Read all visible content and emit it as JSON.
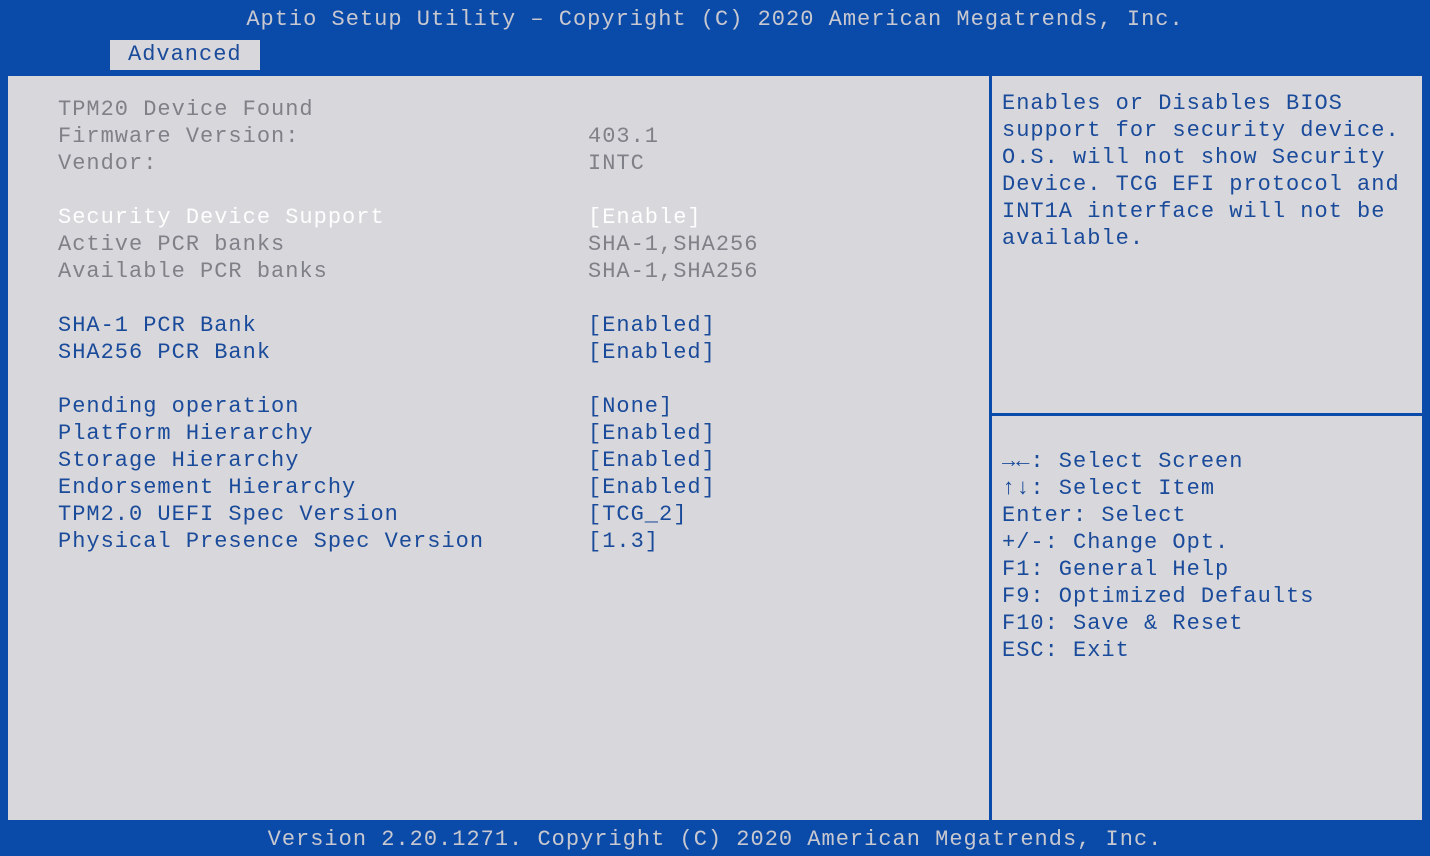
{
  "header": {
    "title": "Aptio Setup Utility – Copyright (C) 2020 American Megatrends, Inc."
  },
  "tabs": {
    "active": "Advanced"
  },
  "info": {
    "device_found": "TPM20 Device Found",
    "firmware_label": "Firmware Version:",
    "firmware_value": "403.1",
    "vendor_label": "Vendor:",
    "vendor_value": "INTC"
  },
  "settings": {
    "security_device_support": {
      "label": "Security Device Support",
      "value": "[Enable]"
    },
    "active_pcr_banks": {
      "label": "Active PCR banks",
      "value": "SHA-1,SHA256"
    },
    "available_pcr_banks": {
      "label": "Available PCR banks",
      "value": "SHA-1,SHA256"
    },
    "sha1_pcr_bank": {
      "label": "SHA-1 PCR Bank",
      "value": "[Enabled]"
    },
    "sha256_pcr_bank": {
      "label": "SHA256 PCR Bank",
      "value": "[Enabled]"
    },
    "pending_operation": {
      "label": "Pending operation",
      "value": "[None]"
    },
    "platform_hierarchy": {
      "label": "Platform Hierarchy",
      "value": "[Enabled]"
    },
    "storage_hierarchy": {
      "label": "Storage Hierarchy",
      "value": "[Enabled]"
    },
    "endorsement_hierarchy": {
      "label": "Endorsement Hierarchy",
      "value": "[Enabled]"
    },
    "tpm_uefi_spec": {
      "label": "TPM2.0 UEFI Spec Version",
      "value": "[TCG_2]"
    },
    "physical_presence": {
      "label": "Physical Presence Spec Version",
      "value": "[1.3]"
    }
  },
  "help": {
    "line1": "Enables or Disables BIOS",
    "line2": "support for security device.",
    "line3": "O.S. will not show Security",
    "line4": "Device. TCG EFI protocol and",
    "line5": "INT1A interface will not be",
    "line6": "available."
  },
  "nav": {
    "select_screen": "→←: Select Screen",
    "select_item": "↑↓: Select Item",
    "enter": "Enter: Select",
    "change": "+/-: Change Opt.",
    "f1": "F1: General Help",
    "f9": "F9: Optimized Defaults",
    "f10": "F10: Save & Reset",
    "esc": "ESC: Exit"
  },
  "footer": {
    "text": "Version 2.20.1271. Copyright (C) 2020 American Megatrends, Inc."
  }
}
